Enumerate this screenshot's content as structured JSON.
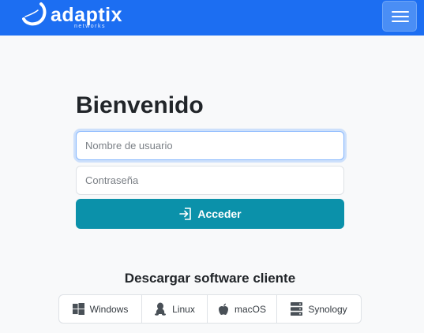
{
  "brand": {
    "name": "adaptix",
    "sub": "networks"
  },
  "colors": {
    "navbar": "#1c6ef2",
    "accent_button": "#0b91aa",
    "background": "#f8f9fa"
  },
  "login": {
    "title": "Bienvenido",
    "username_placeholder": "Nombre de usuario",
    "password_placeholder": "Contraseña",
    "submit_label": "Acceder"
  },
  "downloads": {
    "title": "Descargar software cliente",
    "items": [
      {
        "label": "Windows",
        "icon": "windows-icon"
      },
      {
        "label": "Linux",
        "icon": "linux-icon"
      },
      {
        "label": "macOS",
        "icon": "apple-icon"
      },
      {
        "label": "Synology",
        "icon": "server-icon"
      }
    ]
  }
}
